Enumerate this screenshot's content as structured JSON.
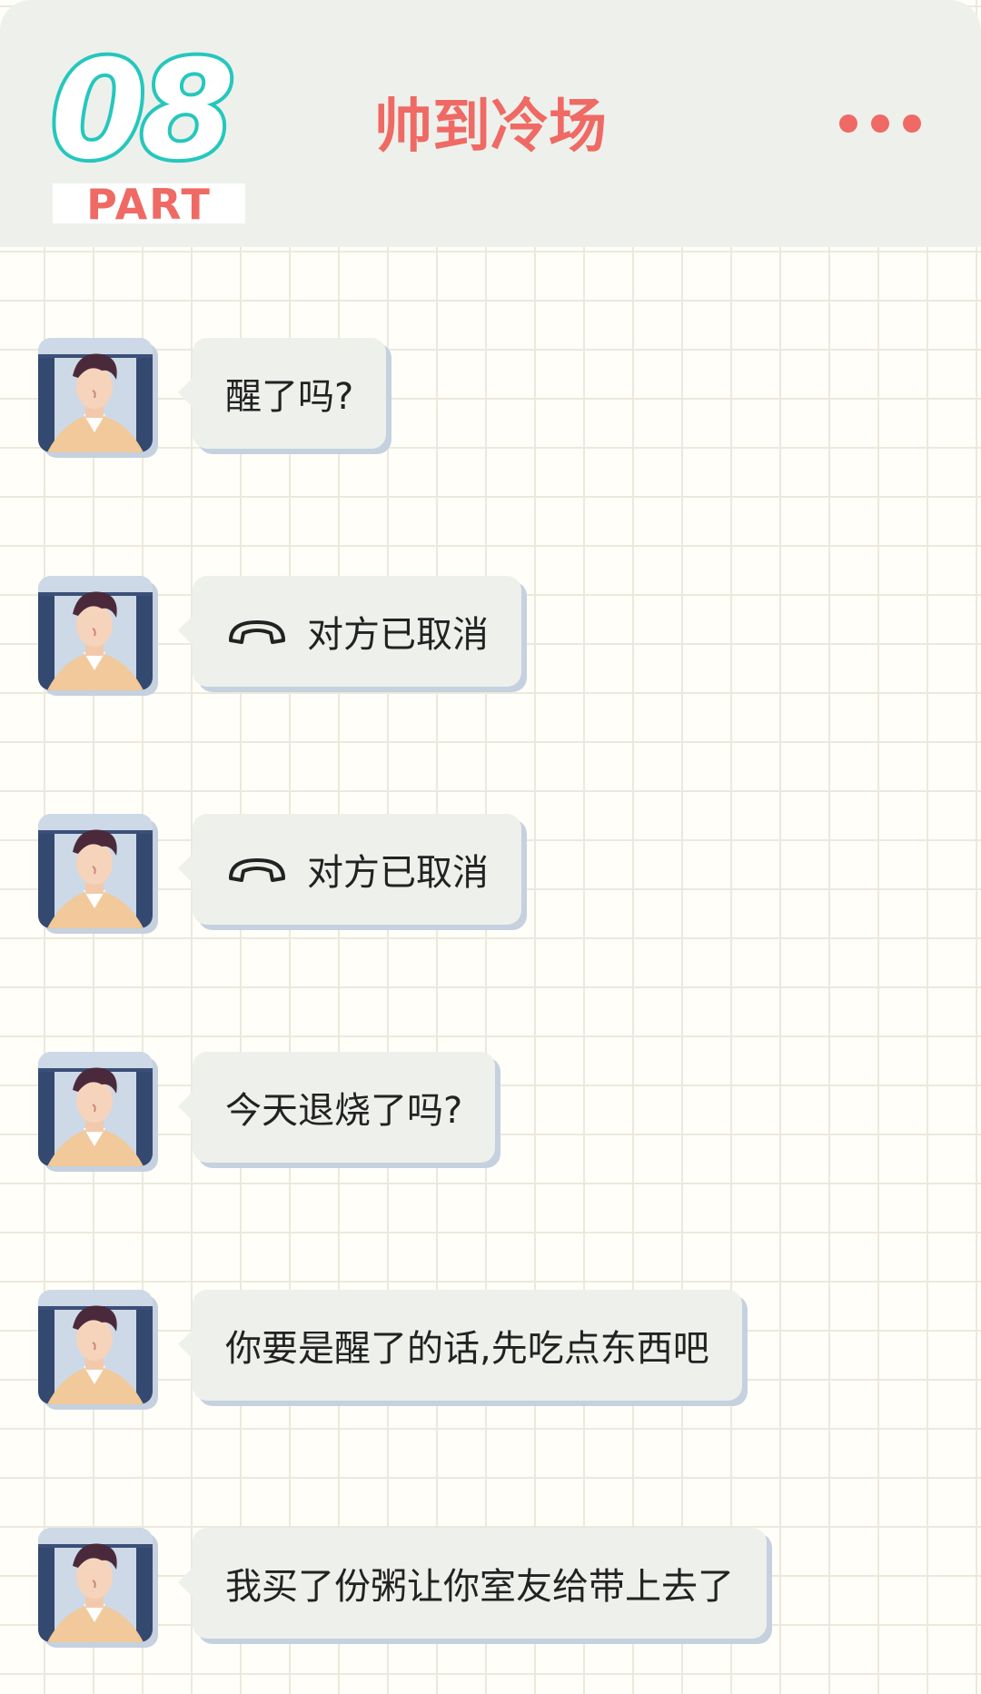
{
  "header": {
    "part_number": "08",
    "part_label": "PART",
    "title": "帅到冷场",
    "more_icon": "more-dots-icon",
    "accent_color": "#ef6a64",
    "badge_color": "#25c7bd"
  },
  "messages": [
    {
      "sender": "avatar",
      "type": "text",
      "text": "醒了吗?"
    },
    {
      "sender": "avatar",
      "type": "call",
      "icon": "hangup-phone-icon",
      "text": "对方已取消"
    },
    {
      "sender": "avatar",
      "type": "call",
      "icon": "hangup-phone-icon",
      "text": "对方已取消"
    },
    {
      "sender": "avatar",
      "type": "text",
      "text": "今天退烧了吗?"
    },
    {
      "sender": "avatar",
      "type": "text",
      "text": "你要是醒了的话,先吃点东西吧"
    },
    {
      "sender": "avatar",
      "type": "text",
      "text": "我买了份粥让你室友给带上去了"
    }
  ]
}
